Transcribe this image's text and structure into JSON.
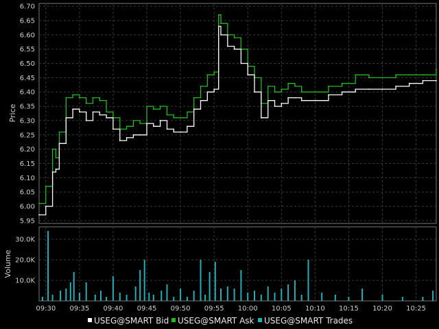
{
  "chart_data": [
    {
      "type": "line",
      "panel": "price",
      "ylabel": "Price",
      "ylim": [
        5.94,
        6.71
      ],
      "yticks": [
        "5.95",
        "6.00",
        "6.05",
        "6.10",
        "6.15",
        "6.20",
        "6.25",
        "6.30",
        "6.35",
        "6.40",
        "6.45",
        "6.50",
        "6.55",
        "6.60",
        "6.65",
        "6.70"
      ],
      "x_range": [
        "09:29",
        "10:28"
      ],
      "grid": true,
      "series": [
        {
          "name": "USEG@SMART Bid",
          "color": "#ffffff",
          "x": [
            "09:29",
            "09:30",
            "09:31",
            "09:31:30",
            "09:32",
            "09:33",
            "09:34",
            "09:35",
            "09:36",
            "09:37",
            "09:38",
            "09:39",
            "09:40",
            "09:41",
            "09:42",
            "09:43",
            "09:44",
            "09:45",
            "09:46",
            "09:47",
            "09:48",
            "09:49",
            "09:50",
            "09:51",
            "09:52",
            "09:53",
            "09:54",
            "09:55",
            "09:55:40",
            "09:56",
            "09:57",
            "09:58",
            "09:59",
            "10:00",
            "10:01",
            "10:02",
            "10:03",
            "10:04",
            "10:05",
            "10:06",
            "10:07",
            "10:08",
            "10:10",
            "10:12",
            "10:14",
            "10:16",
            "10:18",
            "10:20",
            "10:22",
            "10:24",
            "10:26",
            "10:28"
          ],
          "y": [
            5.97,
            6.0,
            6.12,
            6.13,
            6.22,
            6.31,
            6.34,
            6.33,
            6.3,
            6.33,
            6.32,
            6.31,
            6.27,
            6.23,
            6.24,
            6.25,
            6.25,
            6.29,
            6.28,
            6.3,
            6.27,
            6.26,
            6.26,
            6.28,
            6.34,
            6.37,
            6.4,
            6.41,
            6.63,
            6.6,
            6.56,
            6.55,
            6.5,
            6.46,
            6.4,
            6.31,
            6.37,
            6.35,
            6.36,
            6.38,
            6.38,
            6.37,
            6.37,
            6.39,
            6.4,
            6.41,
            6.41,
            6.41,
            6.42,
            6.43,
            6.44,
            6.44
          ]
        },
        {
          "name": "USEG@SMART Ask",
          "color": "#22bb22",
          "x": [
            "09:29",
            "09:30",
            "09:31",
            "09:31:30",
            "09:32",
            "09:33",
            "09:34",
            "09:35",
            "09:36",
            "09:37",
            "09:38",
            "09:39",
            "09:40",
            "09:41",
            "09:42",
            "09:43",
            "09:44",
            "09:45",
            "09:46",
            "09:47",
            "09:48",
            "09:49",
            "09:50",
            "09:51",
            "09:52",
            "09:53",
            "09:54",
            "09:55",
            "09:55:40",
            "09:56",
            "09:57",
            "09:58",
            "09:59",
            "10:00",
            "10:01",
            "10:02",
            "10:03",
            "10:04",
            "10:05",
            "10:06",
            "10:07",
            "10:08",
            "10:10",
            "10:12",
            "10:14",
            "10:16",
            "10:18",
            "10:20",
            "10:22",
            "10:24",
            "10:26",
            "10:28"
          ],
          "y": [
            6.01,
            6.07,
            6.2,
            6.17,
            6.26,
            6.38,
            6.39,
            6.38,
            6.36,
            6.38,
            6.37,
            6.33,
            6.31,
            6.27,
            6.28,
            6.3,
            6.29,
            6.35,
            6.34,
            6.35,
            6.32,
            6.31,
            6.31,
            6.33,
            6.38,
            6.42,
            6.46,
            6.47,
            6.67,
            6.64,
            6.6,
            6.59,
            6.55,
            6.49,
            6.45,
            6.36,
            6.42,
            6.4,
            6.41,
            6.43,
            6.42,
            6.4,
            6.4,
            6.42,
            6.43,
            6.46,
            6.45,
            6.45,
            6.46,
            6.46,
            6.46,
            6.48
          ]
        }
      ]
    },
    {
      "type": "bar",
      "panel": "volume",
      "ylabel": "Volume",
      "ylim": [
        0,
        36000
      ],
      "yticks": [
        "10.0K",
        "20.0K",
        "30.0K"
      ],
      "grid": true,
      "series": [
        {
          "name": "USEG@SMART Trades",
          "color": "#20b0b8",
          "x": [
            "09:29:30",
            "09:30:20",
            "09:31:00",
            "09:32:10",
            "09:33:00",
            "09:33:40",
            "09:34:10",
            "09:35:00",
            "09:36:00",
            "09:37:20",
            "09:38:10",
            "09:39:00",
            "09:40:00",
            "09:41:00",
            "09:42:00",
            "09:43:20",
            "09:44:00",
            "09:44:40",
            "09:45:20",
            "09:46:00",
            "09:47:10",
            "09:48:00",
            "09:49:00",
            "09:50:00",
            "09:51:00",
            "09:52:00",
            "09:53:00",
            "09:53:40",
            "09:54:20",
            "09:55:10",
            "09:56:00",
            "09:57:00",
            "09:58:00",
            "09:59:00",
            "10:00:00",
            "10:01:00",
            "10:02:00",
            "10:03:00",
            "10:04:00",
            "10:05:00",
            "10:06:00",
            "10:07:00",
            "10:08:00",
            "10:09:00",
            "10:11:00",
            "10:13:00",
            "10:15:00",
            "10:17:00",
            "10:20:00",
            "10:23:00",
            "10:26:00",
            "10:27:30"
          ],
          "values": [
            2000,
            34000,
            3000,
            5000,
            6000,
            9000,
            14000,
            4000,
            9000,
            3000,
            5000,
            2000,
            12000,
            4000,
            3000,
            7000,
            15000,
            20000,
            4000,
            3000,
            5000,
            8000,
            2000,
            6000,
            2000,
            5000,
            20000,
            3000,
            14000,
            19000,
            6000,
            7000,
            6000,
            15000,
            4000,
            5000,
            3000,
            7000,
            4000,
            6000,
            8000,
            10000,
            3000,
            20000,
            4000,
            3000,
            2000,
            6000,
            3000,
            2000,
            2000,
            5000
          ]
        }
      ]
    }
  ],
  "x_ticks": [
    "09:30",
    "09:35",
    "09:40",
    "09:45",
    "09:50",
    "09:55",
    "10:00",
    "10:05",
    "10:10",
    "10:15",
    "10:20",
    "10:25"
  ],
  "legend": {
    "placement": "bottom-center",
    "items": [
      {
        "label": "USEG@SMART Bid",
        "color": "#ffffff"
      },
      {
        "label": "USEG@SMART Ask",
        "color": "#22bb22"
      },
      {
        "label": "USEG@SMART Trades",
        "color": "#20b0b8"
      }
    ]
  }
}
